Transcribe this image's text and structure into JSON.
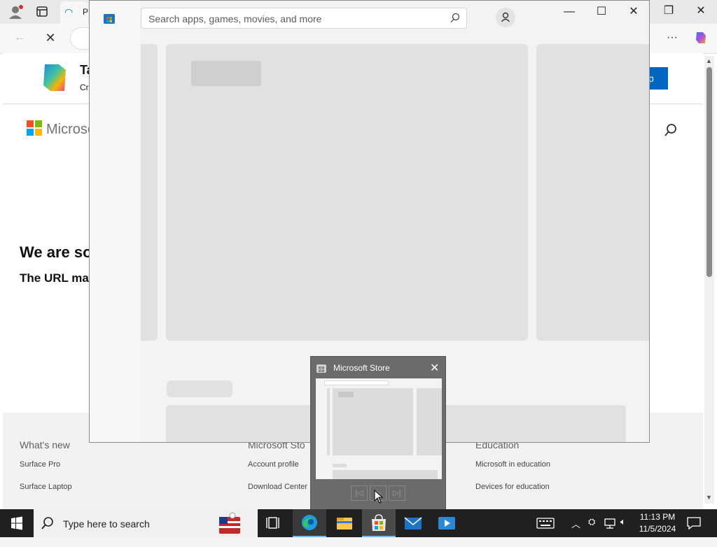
{
  "browser": {
    "tab_title": "P",
    "banner": {
      "title": "Ta",
      "subtitle": "Cr",
      "button": "p"
    },
    "page": {
      "brand": "Microso",
      "heading": "We are so",
      "subheading": "The URL ma"
    },
    "footer": {
      "columns": [
        {
          "title": "What's new",
          "links": [
            "Surface Pro",
            "Surface Laptop"
          ]
        },
        {
          "title": "Microsoft Sto",
          "links": [
            "Account profile",
            "Download Center"
          ]
        },
        {
          "title": "Education",
          "links": [
            "Microsoft in education",
            "Devices for education"
          ]
        }
      ]
    }
  },
  "store": {
    "search_placeholder": "Search apps, games, movies, and more"
  },
  "thumbnail": {
    "title": "Microsoft Store"
  },
  "taskbar": {
    "search_placeholder": "Type here to search",
    "time": "11:13 PM",
    "date": "11/5/2024"
  },
  "colors": {
    "accent": "#0067c0",
    "taskbar": "#202020",
    "thumbnail_bg": "#6b6b6b",
    "skeleton": "#e1e1e1"
  },
  "icons": [
    "profile-icon",
    "tab-actions-icon",
    "back-icon",
    "stop-icon",
    "more-icon",
    "copilot-icon",
    "search-icon",
    "store-icon",
    "account-icon",
    "minimize-icon",
    "maximize-icon",
    "close-icon",
    "windows-start-icon",
    "task-view-icon",
    "edge-icon",
    "file-explorer-icon",
    "mail-icon",
    "media-icon",
    "keyboard-icon",
    "chevron-up-icon",
    "network-icon",
    "volume-icon",
    "notification-icon"
  ]
}
